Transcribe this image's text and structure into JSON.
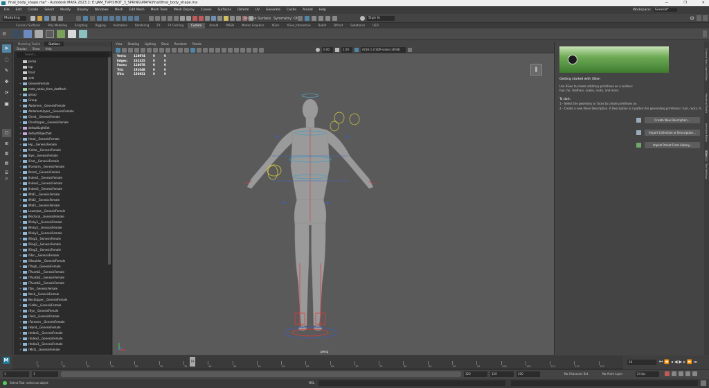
{
  "window": {
    "title": "final_body_shape.ma* - Autodesk MAYA 2023.2: E:\\JAM_TVP\\SHOT_3_SPRING\\MAYA\\final\\final_body_shape.ma",
    "minimize": "—",
    "maximize": "❐",
    "close": "✕"
  },
  "menubar": [
    "File",
    "Edit",
    "Create",
    "Select",
    "Modify",
    "Display",
    "Windows",
    "Mesh",
    "Edit Mesh",
    "Mesh Tools",
    "Mesh Display",
    "Curves",
    "Surfaces",
    "Deform",
    "UV",
    "Generate",
    "Cache",
    "Arnold",
    "Help"
  ],
  "workspace": {
    "label": "Workspace:",
    "value": "General*"
  },
  "status": {
    "mode": "Modeling",
    "symmetry": "Symmetry: Off",
    "live_surface": "No Live Surface",
    "sign_in": "Sign In"
  },
  "shelf_tabs": [
    "Curves / Surfaces",
    "Poly Modeling",
    "Sculpting",
    "Rigging",
    "Animation",
    "Rendering",
    "FX",
    "FX Caching",
    "Custom",
    "Arnold",
    "MASH",
    "Motion Graphics",
    "XGen",
    "XGen_Interactive",
    "Bullet",
    "Bifrost",
    "Substance",
    "USD"
  ],
  "shelf_active": "Custom",
  "outliner": {
    "tabs": [
      "Modeling Toolkit",
      "Outliner"
    ],
    "menu": [
      "Display",
      "Show",
      "Help"
    ],
    "search_placeholder": "Search...",
    "items": [
      {
        "label": "persp",
        "type": "cam"
      },
      {
        "label": "top",
        "type": "cam"
      },
      {
        "label": "front",
        "type": "cam"
      },
      {
        "label": "side",
        "type": "cam"
      },
      {
        "label": "GenesisFemale",
        "type": "grp"
      },
      {
        "label": "mats_tutain_from_dazMesh",
        "type": "mesh"
      },
      {
        "label": "group",
        "type": "grp"
      },
      {
        "label": "Group",
        "type": "grp"
      },
      {
        "label": "Abdomen__GenesisFemale",
        "type": "grp"
      },
      {
        "label": "AbdomenUpper__GenesisFemale",
        "type": "grp"
      },
      {
        "label": "Chest__GenesisFemale",
        "type": "grp"
      },
      {
        "label": "ChestUpper__GenesisFemale",
        "type": "grp"
      },
      {
        "label": "defaultLightSet",
        "type": "set"
      },
      {
        "label": "defaultObjectSet",
        "type": "set"
      },
      {
        "label": "Head__GenesisFemale",
        "type": "grp"
      },
      {
        "label": "Hip__GenesisFemale",
        "type": "grp"
      },
      {
        "label": "lCollar__GenesisFemale",
        "type": "grp"
      },
      {
        "label": "lEye__GenesisFemale",
        "type": "grp"
      },
      {
        "label": "lFoot__GenesisFemale",
        "type": "grp"
      },
      {
        "label": "lForearm__GenesisFemale",
        "type": "grp"
      },
      {
        "label": "lHand__GenesisFemale",
        "type": "grp"
      },
      {
        "label": "lIndex1__GenesisFemale",
        "type": "grp"
      },
      {
        "label": "lIndex2__GenesisFemale",
        "type": "grp"
      },
      {
        "label": "lIndex3__GenesisFemale",
        "type": "grp"
      },
      {
        "label": "lMid1__GenesisFemale",
        "type": "grp"
      },
      {
        "label": "lMid2__GenesisFemale",
        "type": "grp"
      },
      {
        "label": "lMid3__GenesisFemale",
        "type": "grp"
      },
      {
        "label": "LowerJaw__GenesisFemale",
        "type": "grp"
      },
      {
        "label": "lPectoral__GenesisFemale",
        "type": "grp"
      },
      {
        "label": "lPinky1__GenesisFemale",
        "type": "grp"
      },
      {
        "label": "lPinky2__GenesisFemale",
        "type": "grp"
      },
      {
        "label": "lPinky3__GenesisFemale",
        "type": "grp"
      },
      {
        "label": "lRing1__GenesisFemale",
        "type": "grp"
      },
      {
        "label": "lRing2__GenesisFemale",
        "type": "grp"
      },
      {
        "label": "lRing3__GenesisFemale",
        "type": "grp"
      },
      {
        "label": "lShin__GenesisFemale",
        "type": "grp"
      },
      {
        "label": "lShoulder__GenesisFemale",
        "type": "grp"
      },
      {
        "label": "lThigh__GenesisFemale",
        "type": "grp"
      },
      {
        "label": "lThumb1__GenesisFemale",
        "type": "grp"
      },
      {
        "label": "lThumb2__GenesisFemale",
        "type": "grp"
      },
      {
        "label": "lThumb3__GenesisFemale",
        "type": "grp"
      },
      {
        "label": "lToe__GenesisFemale",
        "type": "grp"
      },
      {
        "label": "Neck__GenesisFemale",
        "type": "grp"
      },
      {
        "label": "NeckUpper__GenesisFemale",
        "type": "grp"
      },
      {
        "label": "rCollar__GenesisFemale",
        "type": "grp"
      },
      {
        "label": "rEye__GenesisFemale",
        "type": "grp"
      },
      {
        "label": "rFoot__GenesisFemale",
        "type": "grp"
      },
      {
        "label": "rForearm__GenesisFemale",
        "type": "grp"
      },
      {
        "label": "rHand__GenesisFemale",
        "type": "grp"
      },
      {
        "label": "rIndex1__GenesisFemale",
        "type": "grp"
      },
      {
        "label": "rIndex2__GenesisFemale",
        "type": "grp"
      },
      {
        "label": "rIndex3__GenesisFemale",
        "type": "grp"
      },
      {
        "label": "rMid1__GenesisFemale",
        "type": "grp"
      }
    ]
  },
  "viewport": {
    "menu": [
      "View",
      "Shading",
      "Lighting",
      "Show",
      "Renderer",
      "Panels"
    ],
    "exposure": "0.00",
    "gamma": "1.00",
    "colorspace": "ACES 1.0 SDR-video (sRGB)",
    "camera_label": "persp",
    "hud": [
      {
        "k": "Verts:",
        "v": "118974",
        "a": "0",
        "b": "0"
      },
      {
        "k": "Edges:",
        "v": "232325",
        "a": "0",
        "b": "0"
      },
      {
        "k": "Faces:",
        "v": "116078",
        "a": "0",
        "b": "0"
      },
      {
        "k": "Tris:",
        "v": "191048",
        "a": "0",
        "b": "0"
      },
      {
        "k": "UVs:",
        "v": "156931",
        "a": "0",
        "b": "0"
      }
    ]
  },
  "xgen": {
    "heading": "Getting started with XGen",
    "intro": "Use XGen to create arbitrary primitives on a surface:",
    "intro2": "hair, fur, feathers, scales, rocks, and more.",
    "to_start": "To start:",
    "step1": "1 - Select the geometry or faces to create primitives on.",
    "step2": "2 - Create a new XGen Description. A Description is a pattern for generating primitives ( hair, rocks, trees, etc)",
    "btn_create": "Create New Description...",
    "btn_import_collection": "Import Collection or Description...",
    "btn_import_preset": "Import Preset From Library..."
  },
  "right_strip": [
    "Channel Box / Layer Editor",
    "Modeling Toolkit",
    "Attribute Editor",
    "XGen",
    "Tool Settings"
  ],
  "timeline": {
    "ticks": [
      "5",
      "10",
      "15",
      "20",
      "25",
      "30",
      "35",
      "40",
      "45",
      "50",
      "55",
      "60",
      "65",
      "70",
      "75",
      "80",
      "85",
      "90",
      "95",
      "100",
      "105",
      "110",
      "115",
      "120"
    ],
    "current": "18",
    "current_field": "18"
  },
  "range": {
    "start": "1",
    "inner_start": "1",
    "inner_end": "120",
    "end": "120",
    "end2": "200",
    "character_set": "No Character Set",
    "anim_layer": "No Anim Layer",
    "fps": "24 fps"
  },
  "command": {
    "lang": "MEL",
    "help": "Select Tool: select an object"
  },
  "colors": {
    "accent": "#5285a6",
    "active_tab": "#5a5a5a",
    "joint_red": "#e23a3a",
    "ctrl_blue": "#3e5ec0",
    "ctrl_yellow": "#d8d040"
  }
}
